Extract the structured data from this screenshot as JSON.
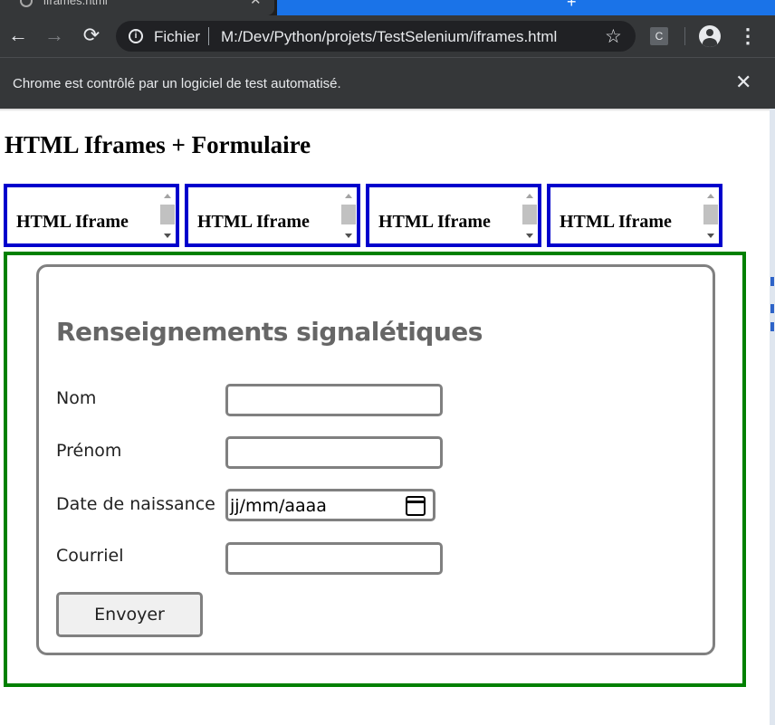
{
  "browser": {
    "tab_title": "iframes.html",
    "url_scheme": "Fichier",
    "url": "M:/Dev/Python/projets/TestSelenium/iframes.html",
    "extension_label": "C",
    "automation_banner": "Chrome est contrôlé par un logiciel de test automatisé."
  },
  "page": {
    "title": "HTML Iframes + Formulaire",
    "iframes": [
      {
        "label": "HTML Iframe"
      },
      {
        "label": "HTML Iframe"
      },
      {
        "label": "HTML Iframe"
      },
      {
        "label": "HTML Iframe"
      }
    ],
    "form": {
      "title": "Renseignements signalétiques",
      "fields": [
        {
          "label": "Nom",
          "value": ""
        },
        {
          "label": "Prénom",
          "value": ""
        },
        {
          "label": "Date de naissance",
          "placeholder": "jj/mm/aaaa"
        },
        {
          "label": "Courriel",
          "value": ""
        }
      ],
      "submit_label": "Envoyer"
    }
  },
  "colors": {
    "iframe_border": "#0000cc",
    "form_frame_border": "#008000",
    "card_border": "#808080",
    "chrome_bg": "#353739",
    "tab_accent": "#1a73e8"
  },
  "icons": [
    "back-arrow-icon",
    "forward-arrow-icon",
    "reload-icon",
    "info-icon",
    "star-icon",
    "profile-icon",
    "kebab-menu-icon",
    "close-icon",
    "calendar-icon"
  ]
}
